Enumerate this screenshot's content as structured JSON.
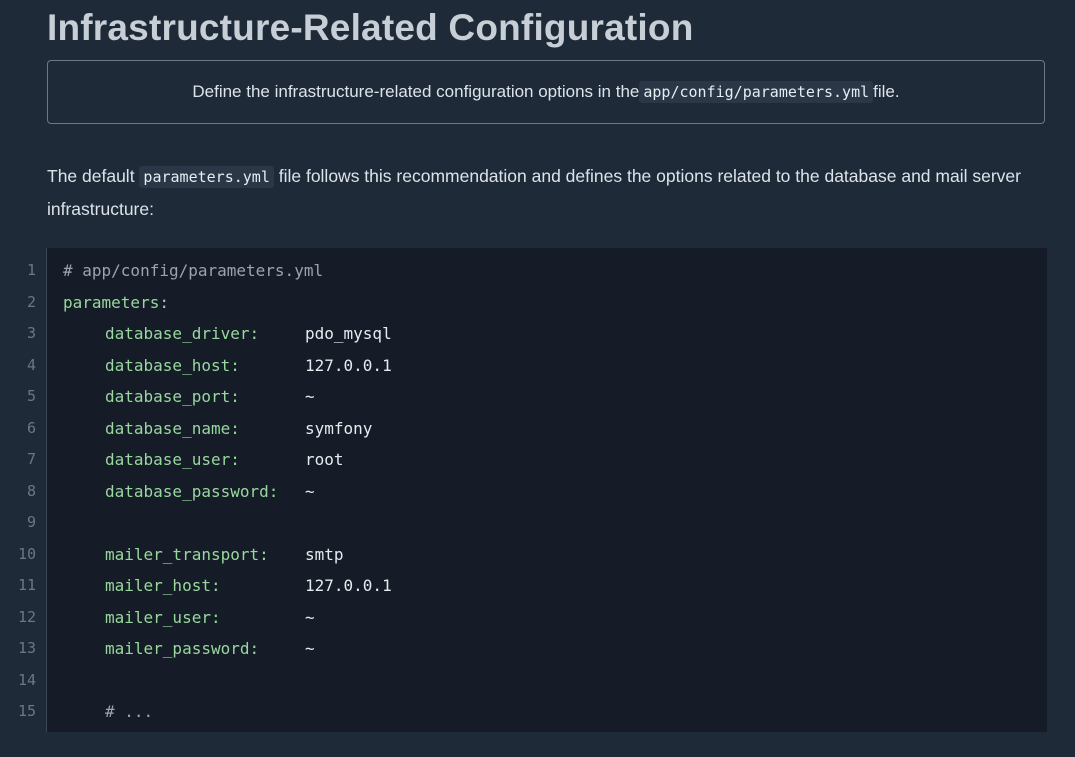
{
  "page": {
    "title": "Infrastructure-Related Configuration"
  },
  "callout": {
    "text_before": "Define the infrastructure-related configuration options in the ",
    "code": "app/config/parameters.yml",
    "text_after": " file."
  },
  "intro": {
    "text_before": "The default ",
    "code": "parameters.yml",
    "text_after": " file follows this recommendation and defines the options related to the database and mail server infrastructure:"
  },
  "code_block": {
    "language": "yaml",
    "lines": [
      {
        "num": "1",
        "comment": "# app/config/parameters.yml"
      },
      {
        "num": "2",
        "key": "parameters:",
        "indent": false
      },
      {
        "num": "3",
        "key": "database_driver:",
        "value": "pdo_mysql",
        "indent": true
      },
      {
        "num": "4",
        "key": "database_host:",
        "value": "127.0.0.1",
        "indent": true
      },
      {
        "num": "5",
        "key": "database_port:",
        "value": "~",
        "indent": true
      },
      {
        "num": "6",
        "key": "database_name:",
        "value": "symfony",
        "indent": true
      },
      {
        "num": "7",
        "key": "database_user:",
        "value": "root",
        "indent": true
      },
      {
        "num": "8",
        "key": "database_password:",
        "value": "~",
        "indent": true
      },
      {
        "num": "9"
      },
      {
        "num": "10",
        "key": "mailer_transport:",
        "value": "smtp",
        "indent": true
      },
      {
        "num": "11",
        "key": "mailer_host:",
        "value": "127.0.0.1",
        "indent": true
      },
      {
        "num": "12",
        "key": "mailer_user:",
        "value": "~",
        "indent": true
      },
      {
        "num": "13",
        "key": "mailer_password:",
        "value": "~",
        "indent": true
      },
      {
        "num": "14"
      },
      {
        "num": "15",
        "comment": "# ...",
        "indent": true
      }
    ],
    "colors": {
      "background": "#151c27",
      "key": "#98d89e",
      "comment": "#9aa4b0",
      "value": "#e6ebf0",
      "line_number": "#6b7786"
    }
  }
}
